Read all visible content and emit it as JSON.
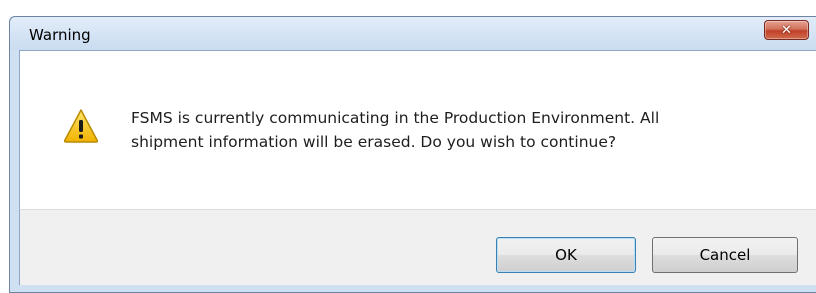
{
  "window": {
    "title": "Warning",
    "close_label": "✕"
  },
  "dialog": {
    "icon": "warning-icon",
    "message_line1": "FSMS is currently communicating in the Production Environment. All",
    "message_line2": "shipment information will be erased. Do you wish to continue?"
  },
  "buttons": {
    "ok_label": "OK",
    "cancel_label": "Cancel"
  },
  "colors": {
    "frame": "#cfe0f3",
    "close_button": "#c1412a",
    "warning_fill": "#f5c400",
    "footer": "#f0f0f0"
  }
}
